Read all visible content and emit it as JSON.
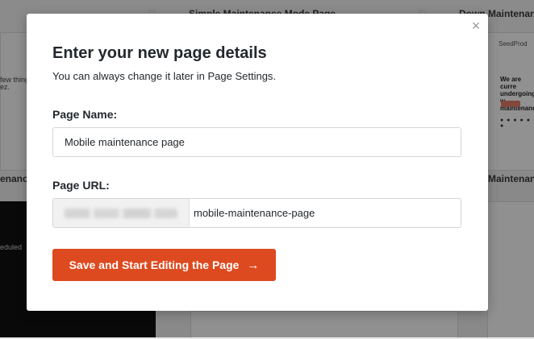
{
  "background": {
    "card_titles": [
      "Simple Maintenance Mode Page",
      "Down Maintenanc"
    ],
    "row_titles": [
      "enance M",
      "Maintenan"
    ],
    "left_snippets": [
      "few things",
      "ez.",
      "eduled"
    ],
    "brand_text": "SeedProd",
    "right_heading": "We are curre undergoing w maintenance"
  },
  "modal": {
    "close_glyph": "×",
    "title": "Enter your new page details",
    "subtitle": "You can always change it later in Page Settings.",
    "page_name_label": "Page Name:",
    "page_name_value": "Mobile maintenance page",
    "page_url_label": "Page URL:",
    "page_url_slug": "mobile-maintenance-page",
    "save_label": "Save and Start Editing the Page",
    "save_arrow": "→"
  },
  "colors": {
    "accent": "#dd4a1f",
    "overlay": "rgba(0,0,0,0.42)"
  },
  "icons": {
    "close": "close-icon",
    "arrow": "arrow-right-icon",
    "favorite": "heart-icon"
  }
}
